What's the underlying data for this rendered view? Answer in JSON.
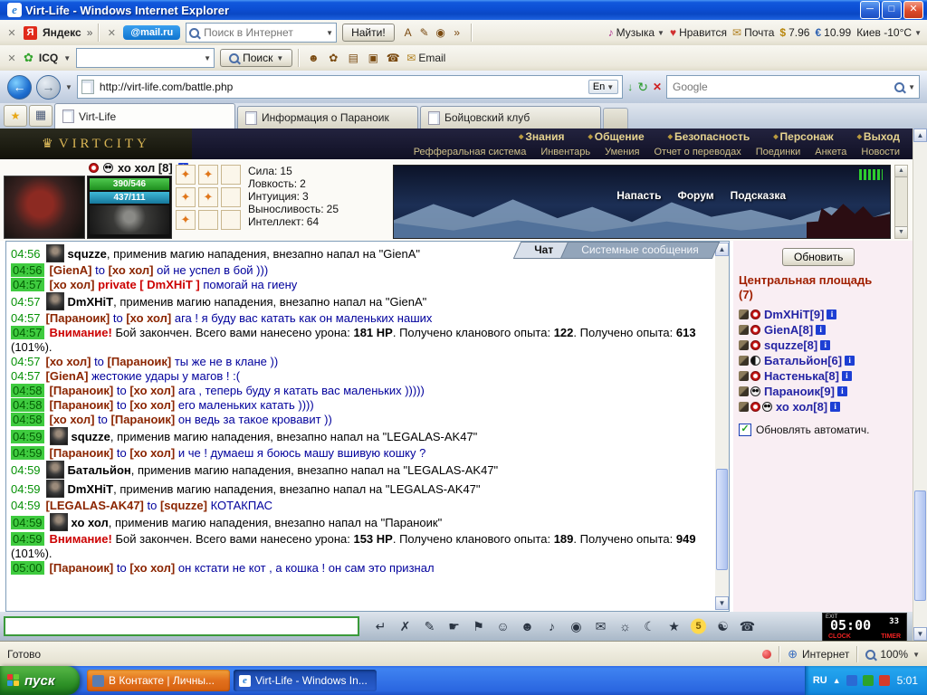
{
  "window": {
    "title": "Virt-Life - Windows Internet Explorer"
  },
  "yandex_bar": {
    "yandex_label": "Яндекс",
    "chevron": "»",
    "mailru_label": "@mail.ru",
    "search_placeholder": "Поиск в Интернет",
    "find_button": "Найти!",
    "tools": [
      {
        "data_name": "font-color-icon",
        "glyph": "A"
      },
      {
        "data_name": "pen-icon",
        "glyph": "✎"
      },
      {
        "data_name": "screenshot-icon",
        "glyph": "◉"
      },
      {
        "data_name": "more-chevron-icon",
        "glyph": "»"
      }
    ],
    "music_label": "Музыка",
    "like_label": "Нравится",
    "mail_label": "Почта",
    "usd_sign": "$",
    "usd_value": "7.96",
    "eur_sign": "€",
    "eur_value": "10.99",
    "weather_value": "Киев -10°C"
  },
  "icq_bar": {
    "icq_label": "ICQ",
    "search_button": "Поиск",
    "email_label": "Email",
    "icons": [
      {
        "data_name": "contacts-icon",
        "glyph": "☻"
      },
      {
        "data_name": "gift-icon",
        "glyph": "✿"
      },
      {
        "data_name": "card-icon",
        "glyph": "▤"
      },
      {
        "data_name": "shield-icon",
        "glyph": "▣"
      },
      {
        "data_name": "phone-icon",
        "glyph": "☎"
      }
    ]
  },
  "address_bar": {
    "url": "http://virt-life.com/battle.php",
    "lang_button": "En",
    "search_placeholder": "Google"
  },
  "browser_tabs": [
    {
      "label": "Virt-Life",
      "active": true,
      "data_name": "tab-virt-life"
    },
    {
      "label": "Информация о Параноик",
      "data_name": "tab-info-paranoik"
    },
    {
      "label": "Бойцовский клуб",
      "data_name": "tab-fight-club"
    }
  ],
  "game": {
    "logo_text": "VIRTCITY",
    "nav_top": [
      {
        "label": "Знания"
      },
      {
        "label": "Общение"
      },
      {
        "label": "Безопасность"
      },
      {
        "label": "Персонаж"
      },
      {
        "label": "Выход"
      }
    ],
    "nav_bottom": [
      {
        "label": "Рефферальная система"
      },
      {
        "label": "Инвентарь"
      },
      {
        "label": "Умения"
      },
      {
        "label": "Отчет о переводах"
      },
      {
        "label": "Поединки"
      },
      {
        "label": "Анкета"
      },
      {
        "label": "Новости"
      }
    ],
    "character": {
      "name": "хо хол [8]",
      "hp_text": "390/546",
      "mp_text": "437/111",
      "stats": [
        {
          "label": "Сила:",
          "value": "15"
        },
        {
          "label": "Ловкость:",
          "value": "2"
        },
        {
          "label": "Интуиция:",
          "value": "3"
        },
        {
          "label": "Выносливость:",
          "value": "25"
        },
        {
          "label": "Интеллект:",
          "value": "64"
        }
      ],
      "equip_slots": [
        {
          "style": "filled"
        },
        {
          "style": "filled"
        },
        {},
        {
          "style": "filled"
        },
        {
          "style": "filled"
        },
        {},
        {
          "style": "filled"
        },
        {},
        {}
      ],
      "battle_links": [
        {
          "label": "Напасть",
          "data_name": "attack-link"
        },
        {
          "label": "Форум",
          "data_name": "forum-link"
        },
        {
          "label": "Подсказка",
          "data_name": "hint-link"
        }
      ]
    },
    "chat_tabs": [
      {
        "label": "Чат",
        "active": true,
        "data_name": "chat-tab-main"
      },
      {
        "label": "Системные сообщения",
        "data_name": "chat-tab-system"
      }
    ],
    "messages": [
      {
        "time": "04:56",
        "av": true,
        "parts": [
          {
            "t": "squzze",
            "c": "b"
          },
          {
            "t": ", применив магию нападения, внезапно напал на \"GienA\"",
            "c": "t"
          }
        ]
      },
      {
        "time": "04:56",
        "hl": true,
        "parts": [
          {
            "t": "[GienA]",
            "c": "n"
          },
          {
            "t": " to ",
            "c": "m"
          },
          {
            "t": "[хо хол]",
            "c": "n"
          },
          {
            "t": " ой не успел в бой )))",
            "c": "m"
          }
        ]
      },
      {
        "time": "04:57",
        "hl": true,
        "parts": [
          {
            "t": "[хо хол]",
            "c": "n"
          },
          {
            "t": " private [ DmXHiT ] ",
            "c": "p"
          },
          {
            "t": "помогай на гиену",
            "c": "m"
          }
        ]
      },
      {
        "time": "04:57",
        "av": true,
        "parts": [
          {
            "t": "DmXHiT",
            "c": "b"
          },
          {
            "t": ", применив магию нападения, внезапно напал на \"GienA\"",
            "c": "t"
          }
        ]
      },
      {
        "time": "04:57",
        "parts": [
          {
            "t": "[Параноик]",
            "c": "n"
          },
          {
            "t": " to ",
            "c": "m"
          },
          {
            "t": "[хо хол]",
            "c": "n"
          },
          {
            "t": " ага ! я буду вас катать как он маленьких наших",
            "c": "m"
          }
        ]
      },
      {
        "time": "04:57",
        "hl": true,
        "parts": [
          {
            "t": "Внимание!",
            "c": "w"
          },
          {
            "t": " Бой закончен. Всего вами нанесено урона: ",
            "c": "t"
          },
          {
            "t": "181 HP",
            "c": "b"
          },
          {
            "t": ". Получено кланового опыта: ",
            "c": "t"
          },
          {
            "t": "122",
            "c": "b"
          },
          {
            "t": ". Получено опыта: ",
            "c": "t"
          },
          {
            "t": "613",
            "c": "b"
          },
          {
            "t": " (101%).",
            "c": "t"
          }
        ]
      },
      {
        "time": "04:57",
        "parts": [
          {
            "t": "[хо хол]",
            "c": "n"
          },
          {
            "t": " to ",
            "c": "m"
          },
          {
            "t": "[Параноик]",
            "c": "n"
          },
          {
            "t": " ты же не в клане ))",
            "c": "m"
          }
        ]
      },
      {
        "time": "04:57",
        "parts": [
          {
            "t": "[GienA]",
            "c": "n"
          },
          {
            "t": " жестокие удары у магов ! :(",
            "c": "m"
          }
        ]
      },
      {
        "time": "04:58",
        "hl": true,
        "parts": [
          {
            "t": "[Параноик]",
            "c": "n"
          },
          {
            "t": " to ",
            "c": "m"
          },
          {
            "t": "[хо хол]",
            "c": "n"
          },
          {
            "t": " ага , теперь буду я катать вас маленьких )))))",
            "c": "m"
          }
        ]
      },
      {
        "time": "04:58",
        "hl": true,
        "parts": [
          {
            "t": "[Параноик]",
            "c": "n"
          },
          {
            "t": " to ",
            "c": "m"
          },
          {
            "t": "[хо хол]",
            "c": "n"
          },
          {
            "t": " его маленьких катать ))))",
            "c": "m"
          }
        ]
      },
      {
        "time": "04:58",
        "hl": true,
        "parts": [
          {
            "t": "[хо хол]",
            "c": "n"
          },
          {
            "t": " to ",
            "c": "m"
          },
          {
            "t": "[Параноик]",
            "c": "n"
          },
          {
            "t": " он ведь за такое кровавит ))",
            "c": "m"
          }
        ]
      },
      {
        "time": "04:59",
        "hl": true,
        "av": true,
        "parts": [
          {
            "t": "squzze",
            "c": "b"
          },
          {
            "t": ", применив магию нападения, внезапно напал на \"LEGALAS-AK47\"",
            "c": "t"
          }
        ]
      },
      {
        "time": "04:59",
        "hl": true,
        "parts": [
          {
            "t": "[Параноик]",
            "c": "n"
          },
          {
            "t": " to ",
            "c": "m"
          },
          {
            "t": "[хо хол]",
            "c": "n"
          },
          {
            "t": " и че ! думаеш я боюсь машу вшивую кошку ?",
            "c": "m"
          }
        ]
      },
      {
        "time": "04:59",
        "av": true,
        "parts": [
          {
            "t": "Батальйон",
            "c": "b"
          },
          {
            "t": ", применив магию нападения, внезапно напал на \"LEGALAS-AK47\"",
            "c": "t"
          }
        ]
      },
      {
        "time": "04:59",
        "av": true,
        "parts": [
          {
            "t": "DmXHiT",
            "c": "b"
          },
          {
            "t": ", применив магию нападения, внезапно напал на \"LEGALAS-AK47\"",
            "c": "t"
          }
        ]
      },
      {
        "time": "04:59",
        "parts": [
          {
            "t": "[LEGALAS-AK47]",
            "c": "n"
          },
          {
            "t": " to ",
            "c": "m"
          },
          {
            "t": "[squzze]",
            "c": "n"
          },
          {
            "t": " КОТАКПАС",
            "c": "m"
          }
        ]
      },
      {
        "time": "04:59",
        "hl": true,
        "av": true,
        "parts": [
          {
            "t": "хо хол",
            "c": "b"
          },
          {
            "t": ", применив магию нападения, внезапно напал на \"Параноик\"",
            "c": "t"
          }
        ]
      },
      {
        "time": "04:59",
        "hl": true,
        "parts": [
          {
            "t": "Внимание!",
            "c": "w"
          },
          {
            "t": " Бой закончен. Всего вами нанесено урона: ",
            "c": "t"
          },
          {
            "t": "153 HP",
            "c": "b"
          },
          {
            "t": ". Получено кланового опыта: ",
            "c": "t"
          },
          {
            "t": "189",
            "c": "b"
          },
          {
            "t": ". Получено опыта: ",
            "c": "t"
          },
          {
            "t": "949",
            "c": "b"
          },
          {
            "t": " (101%).",
            "c": "t"
          }
        ]
      },
      {
        "time": "05:00",
        "hl": true,
        "parts": [
          {
            "t": "[Параноик]",
            "c": "n"
          },
          {
            "t": " to ",
            "c": "m"
          },
          {
            "t": "[хо хол]",
            "c": "n"
          },
          {
            "t": " он кстати не кот , а кошка ! он сам это признал",
            "c": "m"
          }
        ]
      }
    ],
    "sidebar": {
      "refresh_button": "Обновить",
      "location_title": "Центральная площадь",
      "location_count": "(7)",
      "players": [
        {
          "name": "DmXHiT",
          "level": "[9]",
          "icons": [
            "attack-icon",
            "clan-badge-icon"
          ]
        },
        {
          "name": "GienA",
          "level": "[8]",
          "icons": [
            "attack-icon",
            "clan-badge-icon"
          ]
        },
        {
          "name": "squzze",
          "level": "[8]",
          "icons": [
            "attack-icon",
            "clan-badge-icon"
          ]
        },
        {
          "name": "Батальйон",
          "level": "[6]",
          "icons": [
            "attack-icon",
            "yin-yang-icon"
          ]
        },
        {
          "name": "Настенька",
          "level": "[8]",
          "icons": [
            "attack-icon",
            "clan-badge-icon"
          ]
        },
        {
          "name": "Параноик",
          "level": "[9]",
          "icons": [
            "attack-icon",
            "cat-icon"
          ]
        },
        {
          "name": "хо хол",
          "level": "[8]",
          "icons": [
            "attack-icon",
            "clan-badge-icon",
            "panda-icon"
          ]
        }
      ],
      "auto_refresh_label": "Обновлять автоматич."
    },
    "bottom_toolbar": {
      "icons": [
        {
          "data_name": "enter-icon",
          "glyph": "↵"
        },
        {
          "data_name": "clear-icon",
          "glyph": "✗"
        },
        {
          "data_name": "draw-icon",
          "glyph": "✎"
        },
        {
          "data_name": "point-icon",
          "glyph": "☛"
        },
        {
          "data_name": "flag-icon",
          "glyph": "⚑"
        },
        {
          "data_name": "smiley-icon",
          "glyph": "☺"
        },
        {
          "data_name": "dark-smiley-icon",
          "glyph": "☻"
        },
        {
          "data_name": "music-icon",
          "glyph": "♪"
        },
        {
          "data_name": "target-icon",
          "glyph": "◉"
        },
        {
          "data_name": "mail-icon",
          "glyph": "✉"
        },
        {
          "data_name": "sun-icon",
          "glyph": "☼"
        },
        {
          "data_name": "moon-icon",
          "glyph": "☾"
        },
        {
          "data_name": "star-icon",
          "glyph": "★"
        },
        {
          "data_name": "coin-icon",
          "glyph": "5"
        },
        {
          "data_name": "yinyang-icon",
          "glyph": "☯"
        },
        {
          "data_name": "chat-bubble-icon",
          "glyph": "☎"
        }
      ]
    },
    "clock": {
      "time": "05:00",
      "seconds": "33",
      "exit_label": "EXIT",
      "clock_label": "CLOCK",
      "timer_label": "TIMER"
    }
  },
  "status_bar": {
    "ready": "Готово",
    "zone": "Интернет",
    "zoom": "100%"
  },
  "taskbar": {
    "start_label": "пуск",
    "tasks": [
      {
        "label": "В Контакте | Личны...",
        "style": "alert"
      },
      {
        "label": "Virt-Life - Windows In...",
        "style": "activewin"
      }
    ],
    "lang": "RU",
    "time": "5:01"
  }
}
